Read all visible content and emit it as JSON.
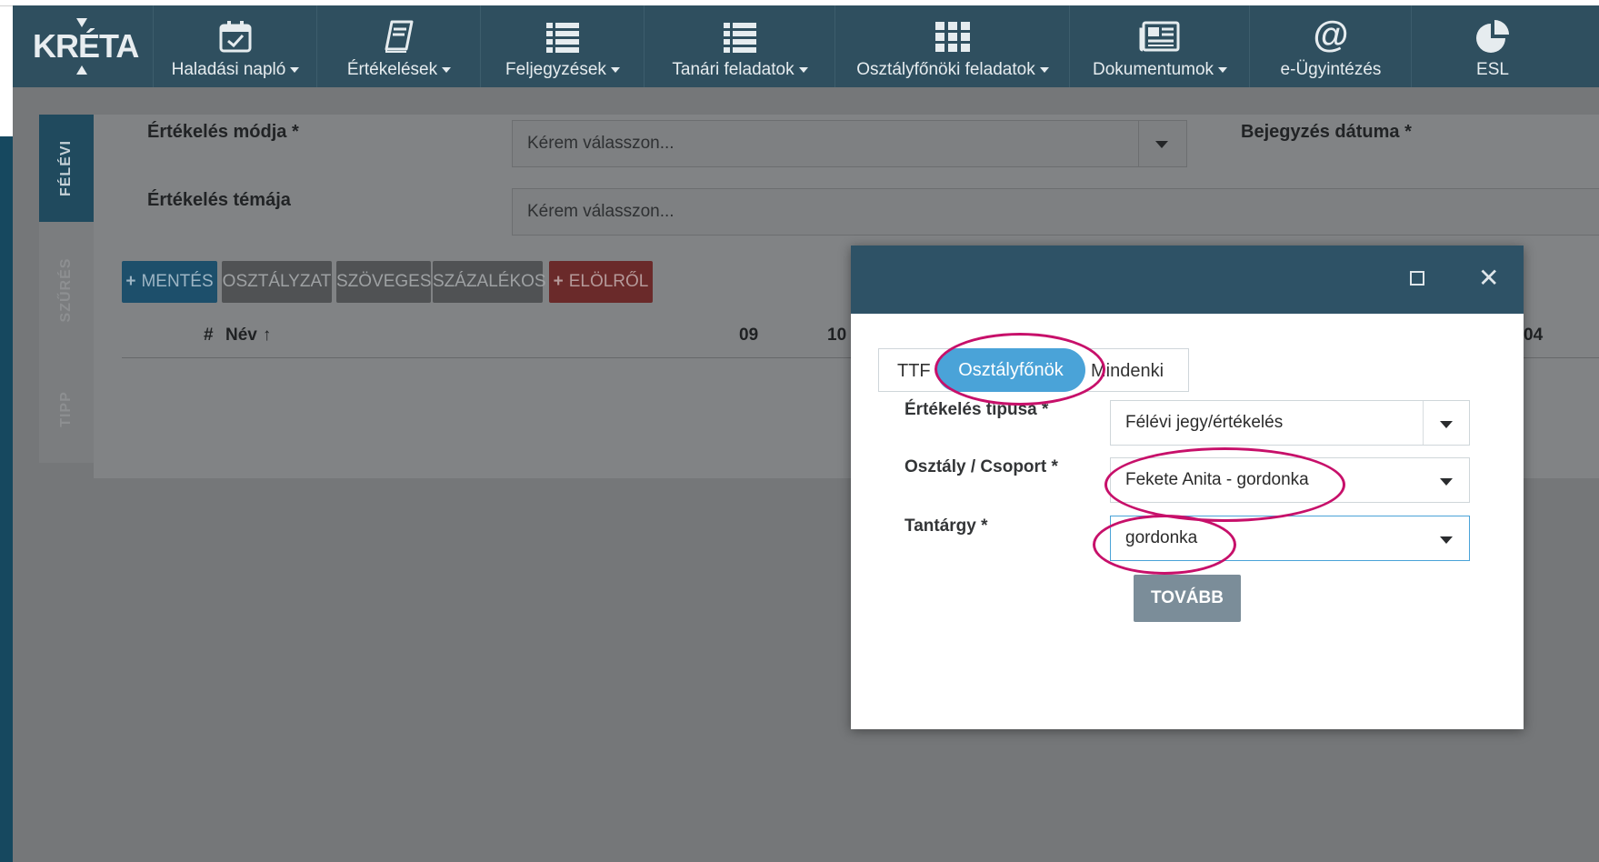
{
  "logo": "KRÉTA",
  "nav": [
    {
      "label": "Haladási napló",
      "icon": "calendar-check-icon",
      "dropdown": true
    },
    {
      "label": "Értékelések",
      "icon": "book-icon",
      "dropdown": true
    },
    {
      "label": "Feljegyzések",
      "icon": "list-icon",
      "dropdown": true
    },
    {
      "label": "Tanári feladatok",
      "icon": "list-icon",
      "dropdown": true
    },
    {
      "label": "Osztályfőnöki feladatok",
      "icon": "grid-icon",
      "dropdown": true
    },
    {
      "label": "Dokumentumok",
      "icon": "newspaper-icon",
      "dropdown": true
    },
    {
      "label": "e-Ügyintézés",
      "icon": "at-icon",
      "dropdown": false
    },
    {
      "label": "ESL",
      "icon": "pie-chart-icon",
      "dropdown": false
    }
  ],
  "side_tabs": {
    "felevi": "FÉLÉVI",
    "szures": "SZŰRÉS",
    "tipp": "TIPP"
  },
  "form": {
    "mode_label": "Értékelés módja *",
    "mode_placeholder": "Kérem válasszon...",
    "date_label": "Bejegyzés dátuma *",
    "topic_label": "Értékelés témája",
    "topic_placeholder": "Kérem válasszon..."
  },
  "toolbar": {
    "save": "MENTÉS",
    "grade": "OSZTÁLYZAT",
    "text": "SZÖVEGES",
    "percent": "SZÁZALÉKOS",
    "reset": "ELÖLRŐL"
  },
  "table_header": {
    "hash": "#",
    "name": "Név",
    "c09": "09",
    "c10": "10",
    "c04": "04"
  },
  "modal": {
    "tabs": [
      "TTF",
      "Osztályfőnök",
      "Mindenki"
    ],
    "active_tab": "Osztályfőnök",
    "type_label": "Értékelés típusa *",
    "type_value": "Félévi jegy/értékelés",
    "class_label": "Osztály / Csoport *",
    "class_value": "Fekete Anita - gordonka",
    "subject_label": "Tantárgy *",
    "subject_value": "gordonka",
    "next": "TOVÁBB"
  },
  "colors": {
    "navbar": "#2f4f5f",
    "modal_header": "#2e5266",
    "active_tab": "#4aa3d8",
    "highlight": "#c7106a",
    "next_button": "#7b8d99"
  }
}
